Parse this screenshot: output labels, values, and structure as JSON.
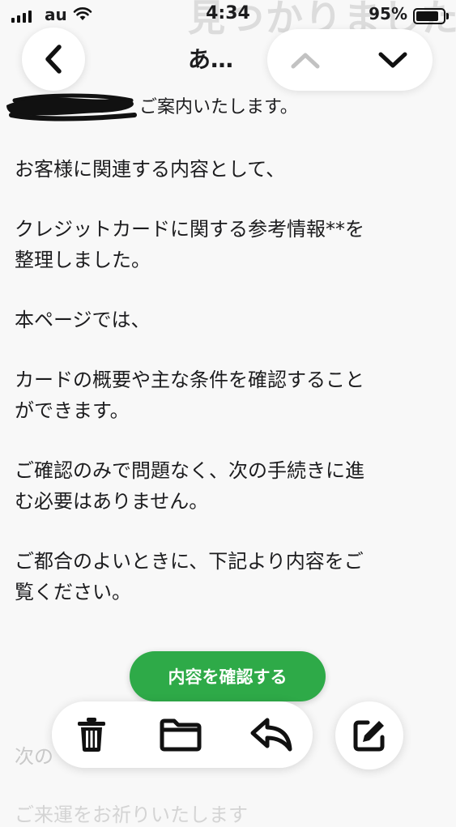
{
  "status_bar": {
    "carrier": "au",
    "time": "4:34",
    "battery_percent": "95%",
    "battery_level": 0.95
  },
  "nav": {
    "title": "あ…",
    "background_title": "見つかりました"
  },
  "email": {
    "greeting_line": "ご案内いたします。",
    "paragraphs": [
      "お客様に関連する内容として、",
      "クレジットカードに関する参考情報**を\n整理しました。",
      "本ページでは、",
      "カードの概要や主な条件を確認すること\nができます。",
      "ご確認のみで問題なく、次の手続きに進\nむ必要はありません。",
      "ご都合のよいときに、下記より内容をご\n覧ください。"
    ],
    "cta_label": "内容を確認する",
    "faded_line_1": "次の",
    "faded_line_2": "ご来運をお祈りいたします"
  },
  "icons": {
    "back": "chevron-left-icon",
    "up": "chevron-up-icon",
    "down": "chevron-down-icon",
    "trash": "trash-icon",
    "folder": "folder-icon",
    "reply": "reply-icon",
    "compose": "compose-icon"
  },
  "colors": {
    "cta_green": "#2eaa48",
    "background": "#f8f8f8",
    "text": "#1c1c1e"
  }
}
